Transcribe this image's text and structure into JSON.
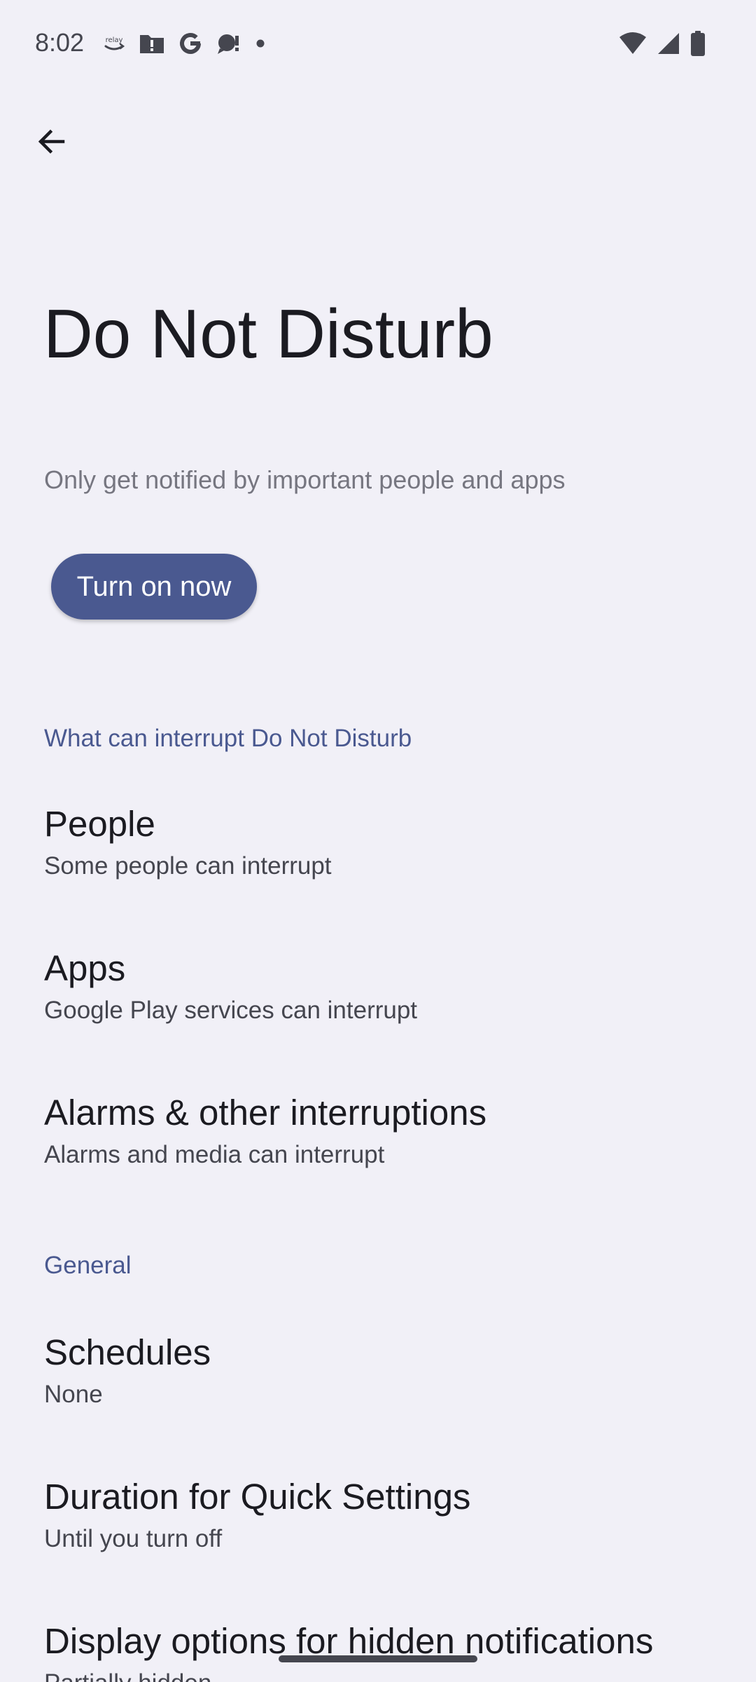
{
  "status_bar": {
    "time": "8:02",
    "left_icons": [
      "relay-icon",
      "alert-folder-icon",
      "google-icon",
      "chat-icon",
      "dot-icon"
    ],
    "right_icons": [
      "wifi-icon",
      "signal-icon",
      "battery-icon"
    ],
    "relay_text": "relay"
  },
  "toolbar": {
    "back_icon": "arrow-back-icon"
  },
  "header": {
    "title": "Do Not Disturb",
    "description": "Only get notified by important people and apps",
    "turn_on_label": "Turn on now"
  },
  "sections": [
    {
      "header": "What can interrupt Do Not Disturb",
      "items": [
        {
          "title": "People",
          "summary": "Some people can interrupt"
        },
        {
          "title": "Apps",
          "summary": "Google Play services can interrupt"
        },
        {
          "title": "Alarms & other interruptions",
          "summary": "Alarms and media can interrupt"
        }
      ]
    },
    {
      "header": "General",
      "items": [
        {
          "title": "Schedules",
          "summary": "None"
        },
        {
          "title": "Duration for Quick Settings",
          "summary": "Until you turn off"
        },
        {
          "title": "Display options for hidden notifications",
          "summary": "Partially hidden"
        }
      ]
    }
  ],
  "colors": {
    "background": "#f1f0f7",
    "accent": "#4a5990",
    "text_primary": "#1b1b21",
    "text_secondary": "#45464f"
  }
}
